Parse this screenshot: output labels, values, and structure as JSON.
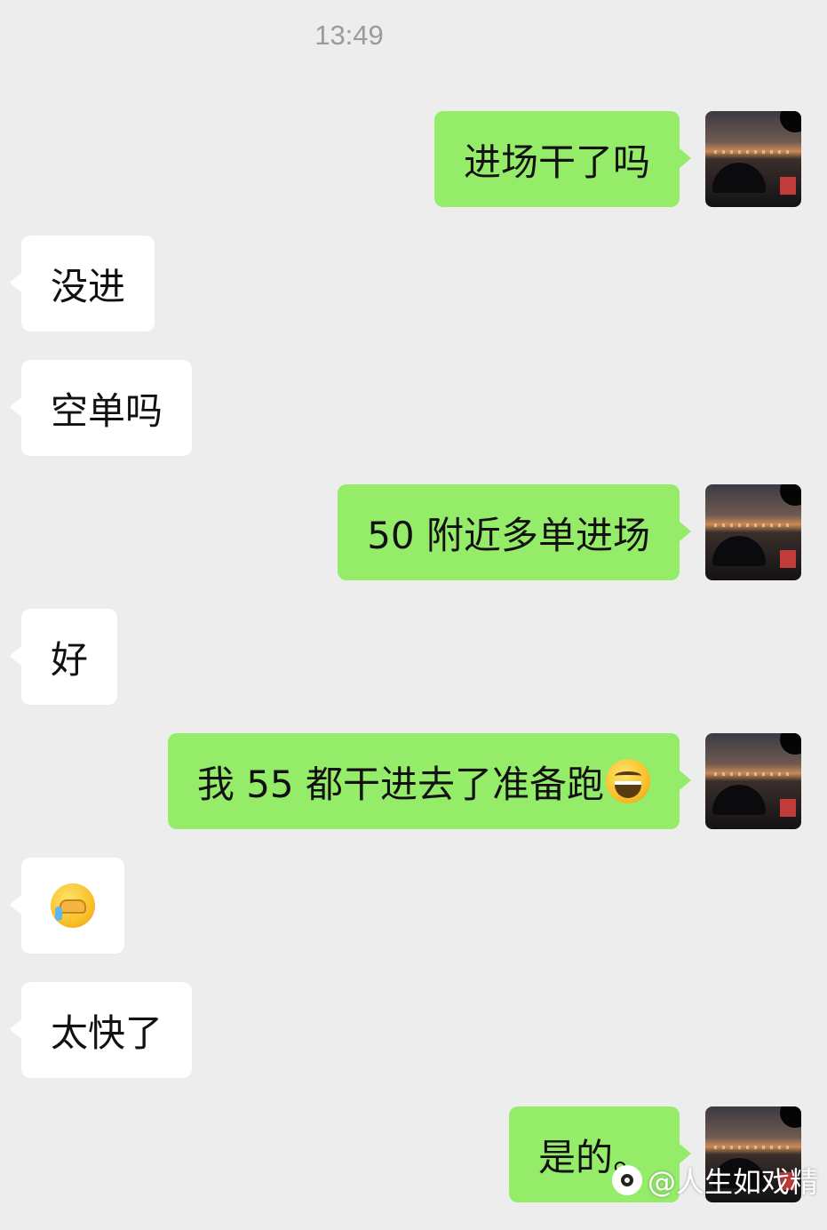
{
  "chat": {
    "timestamp": "13:49",
    "messages": [
      {
        "direction": "out",
        "text": "进场干了吗"
      },
      {
        "direction": "in",
        "text": "没进"
      },
      {
        "direction": "in",
        "text": "空单吗"
      },
      {
        "direction": "out",
        "text": "50 附近多单进场"
      },
      {
        "direction": "in",
        "text": "好"
      },
      {
        "direction": "out",
        "text": "我 55 都干进去了准备跑",
        "emoji": "grinning-face"
      },
      {
        "direction": "in",
        "text": "",
        "emoji": "facepalm-tears"
      },
      {
        "direction": "in",
        "text": "太快了"
      },
      {
        "direction": "out",
        "text": "是的。"
      }
    ]
  },
  "colors": {
    "background": "#ededed",
    "outgoing_bubble": "#95ec69",
    "incoming_bubble": "#ffffff",
    "timestamp": "#9b9b9b"
  },
  "watermark": {
    "text": "@人生如戏精",
    "icon": "platform-logo-icon"
  }
}
